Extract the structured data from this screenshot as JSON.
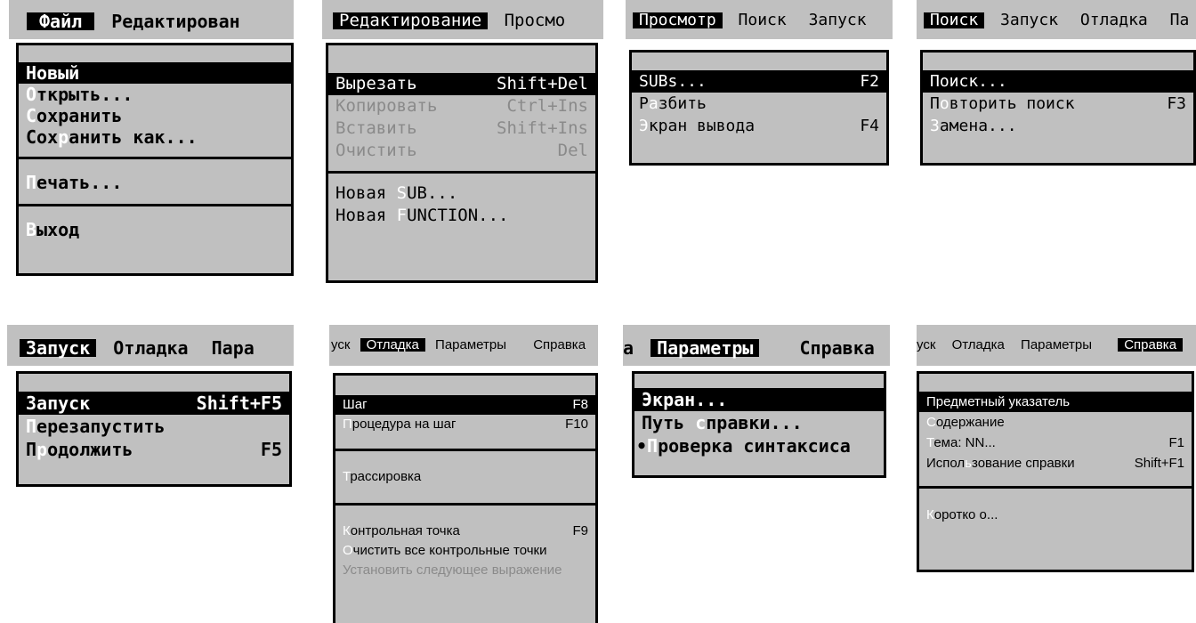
{
  "panels": [
    {
      "bar": [
        "Файл",
        "Редактирован"
      ],
      "items": [
        {
          "pre": "",
          "hk": "Н",
          "post": "овый",
          "sc": ""
        },
        {
          "pre": "",
          "hk": "О",
          "post": "ткрыть...",
          "sc": ""
        },
        {
          "pre": "",
          "hk": "С",
          "post": "охранить",
          "sc": ""
        },
        {
          "pre": "Сох",
          "hk": "р",
          "post": "анить как...",
          "sc": ""
        },
        {
          "pre": "",
          "hk": "П",
          "post": "ечать...",
          "sc": ""
        },
        {
          "pre": "",
          "hk": "В",
          "post": "ыход",
          "sc": ""
        }
      ]
    },
    {
      "bar": [
        "Редактирование",
        "Просмо"
      ],
      "items": [
        {
          "pre": "",
          "hk": "",
          "post": "Вырезать",
          "sc": "Shift+Del"
        },
        {
          "pre": "",
          "hk": "",
          "post": "Копировать",
          "sc": "Ctrl+Ins"
        },
        {
          "pre": "",
          "hk": "",
          "post": "Вставить",
          "sc": "Shift+Ins"
        },
        {
          "pre": "",
          "hk": "",
          "post": "Очистить",
          "sc": "Del"
        },
        {
          "pre": "Новая ",
          "hk": "S",
          "post": "UB...",
          "sc": ""
        },
        {
          "pre": "Новая ",
          "hk": "F",
          "post": "UNCTION...",
          "sc": ""
        }
      ]
    },
    {
      "bar": [
        "Просмотр",
        "Поиск",
        "Запуск"
      ],
      "items": [
        {
          "pre": "",
          "hk": "",
          "post": "SUBs...",
          "sc": "F2"
        },
        {
          "pre": "Р",
          "hk": "а",
          "post": "збить",
          "sc": ""
        },
        {
          "pre": "",
          "hk": "Э",
          "post": "кран вывода",
          "sc": "F4"
        }
      ]
    },
    {
      "bar": [
        "Поиск",
        "Запуск",
        "Отладка",
        "Па"
      ],
      "items": [
        {
          "pre": "",
          "hk": "",
          "post": "Поиск...",
          "sc": ""
        },
        {
          "pre": "П",
          "hk": "о",
          "post": "вторить поиск",
          "sc": "F3"
        },
        {
          "pre": "",
          "hk": "З",
          "post": "амена...",
          "sc": ""
        }
      ]
    },
    {
      "bar": [
        "Запуск",
        "Отладка",
        "Пара"
      ],
      "items": [
        {
          "pre": "",
          "hk": "",
          "post": "Запуск",
          "sc": "Shift+F5"
        },
        {
          "pre": "",
          "hk": "П",
          "post": "ерезапустить",
          "sc": ""
        },
        {
          "pre": "П",
          "hk": "р",
          "post": "одолжить",
          "sc": "F5"
        }
      ]
    },
    {
      "bar": [
        "уск",
        "Отладка",
        "Параметры",
        "Справка"
      ],
      "items": [
        {
          "pre": "",
          "hk": "",
          "post": "Шаг",
          "sc": "F8"
        },
        {
          "pre": "",
          "hk": "П",
          "post": "роцедура на шаг",
          "sc": "F10"
        },
        {
          "pre": "",
          "hk": "Т",
          "post": "рассировка",
          "sc": ""
        },
        {
          "pre": "",
          "hk": "К",
          "post": "онтрольная точка",
          "sc": "F9"
        },
        {
          "pre": "",
          "hk": "О",
          "post": "чистить все контрольные точки",
          "sc": ""
        },
        {
          "pre": "",
          "hk": "",
          "post": "Установить следующее выражение",
          "sc": ""
        }
      ]
    },
    {
      "bar": [
        "а",
        "Параметры",
        "Справка"
      ],
      "items": [
        {
          "pre": "",
          "hk": "",
          "post": "Экран...",
          "sc": ""
        },
        {
          "pre": "Путь ",
          "hk": "с",
          "post": "правки...",
          "sc": ""
        },
        {
          "pre": "•",
          "hk": "П",
          "post": "роверка синтаксиса",
          "sc": ""
        }
      ]
    },
    {
      "bar": [
        "уск",
        "Отладка",
        "Параметры",
        "Справка"
      ],
      "items": [
        {
          "pre": "",
          "hk": "",
          "post": "Предметный указатель",
          "sc": ""
        },
        {
          "pre": "",
          "hk": "С",
          "post": "одержание",
          "sc": ""
        },
        {
          "pre": "",
          "hk": "Т",
          "post": "ема: NN...",
          "sc": "F1"
        },
        {
          "pre": "Испол",
          "hk": "ь",
          "post": "зование справки",
          "sc": "Shift+F1"
        },
        {
          "pre": "",
          "hk": "К",
          "post": "оротко о...",
          "sc": ""
        }
      ]
    }
  ]
}
